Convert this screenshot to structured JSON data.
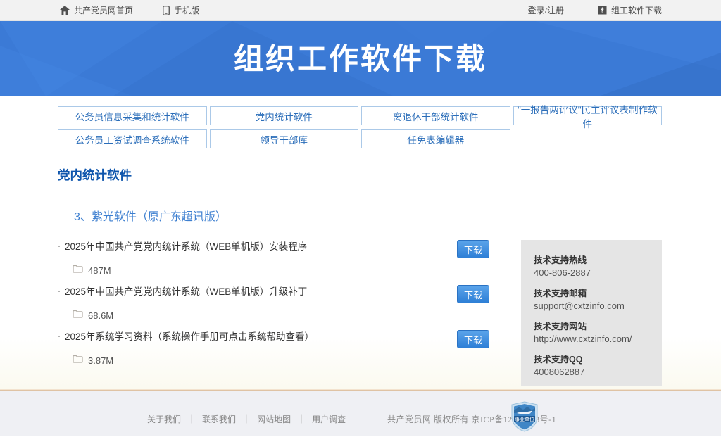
{
  "topbar": {
    "home_link": "共产党员网首页",
    "mobile_link": "手机版",
    "login_link": "登录/注册",
    "software_link": "组工软件下载"
  },
  "banner": {
    "title": "组织工作软件下载"
  },
  "nav": {
    "items": [
      "公务员信息采集和统计软件",
      "党内统计软件",
      "离退休干部统计软件",
      "\"一报告两评议\"民主评议表制作软件",
      "公务员工资试调查系统软件",
      "领导干部库",
      "任免表编辑器"
    ]
  },
  "main": {
    "section_title": "党内统计软件",
    "subsection_title": "3、紫光软件（原广东超讯版）",
    "download_label": "下载",
    "items": [
      {
        "title": "2025年中国共产党党内统计系统（WEB单机版）安装程序",
        "size": "487M"
      },
      {
        "title": "2025年中国共产党党内统计系统（WEB单机版）升级补丁",
        "size": "68.6M"
      },
      {
        "title": "2025年系统学习资料（系统操作手册可点击系统帮助查看）",
        "size": "3.87M"
      }
    ]
  },
  "support": {
    "hotline_label": "技术支持热线",
    "hotline_value": "400-806-2887",
    "email_label": "技术支持邮箱",
    "email_value": "support@cxtzinfo.com",
    "website_label": "技术支持网站",
    "website_value": "http://www.cxtzinfo.com/",
    "qq_label": "技术支持QQ",
    "qq_value": "4008062887"
  },
  "footer": {
    "links": [
      "关于我们",
      "联系我们",
      "网站地图",
      "用户调查"
    ],
    "separator": "｜",
    "copyright": "共产党员网 版权所有 京ICP备12024993号-1",
    "badge_label": "事业单位"
  },
  "colors": {
    "banner_blue": "#3b7ad6",
    "nav_border_blue": "#abc9e8",
    "accent_blue": "#2a6db9",
    "section_title_blue": "#0f56ad",
    "button_gradient_top": "#5ba4ea",
    "button_gradient_bottom": "#2e7fd6",
    "support_box_gray": "#e5e5e5",
    "separator_tan": "#dfc3a4",
    "footer_gray": "#eff0f4"
  }
}
